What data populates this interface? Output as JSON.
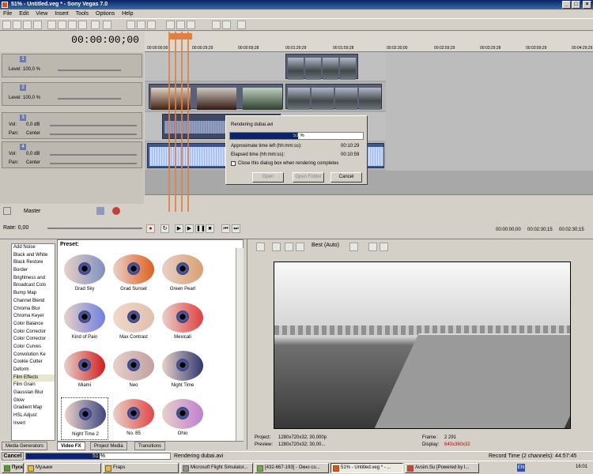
{
  "window": {
    "title": "51% - Untitled.veg * - Sony Vegas 7.0",
    "min": "_",
    "max": "□",
    "close": "×"
  },
  "menu": [
    "File",
    "Edit",
    "View",
    "Insert",
    "Tools",
    "Options",
    "Help"
  ],
  "timecode": "00:00:00;00",
  "ruler": [
    "00:00:00;00",
    "00:00:29;29",
    "00:00:59;28",
    "00:01:29;29",
    "00:01:59;28",
    "00:02:30;00",
    "00:02:59;29",
    "00:03:29;28",
    "00:03:59;29",
    "00:04:29;29"
  ],
  "tracks": [
    {
      "num": "1",
      "label": "Level:",
      "value": "100,0 %"
    },
    {
      "num": "2",
      "label": "Level:",
      "value": "100,0 %"
    },
    {
      "num": "3",
      "vol_label": "Vol:",
      "vol": "0,0 dB",
      "pan_label": "Pan:",
      "pan": "Center"
    },
    {
      "num": "4",
      "vol_label": "Vol:",
      "vol": "0,0 dB",
      "pan_label": "Pan:",
      "pan": "Center"
    }
  ],
  "master": "Master",
  "rate": "Rate: 0,00",
  "transport_time": [
    "00:00:00;00",
    "00:02:30;15",
    "00:02:30;15"
  ],
  "dialog": {
    "title": "Rendering dubai.avi",
    "progress": 0.51,
    "progress_text": "51 %",
    "approx_label": "Approximate time left (hh:mm:ss):",
    "approx": "00:10:29",
    "elapsed_label": "Elapsed time (hh:mm:ss):",
    "elapsed": "00:10:59",
    "close_label": "Close this dialog box when rendering completes",
    "open": "Open",
    "open_folder": "Open Folder",
    "cancel": "Cancel"
  },
  "fx_list": [
    "Add Noise",
    "Black and White",
    "Black Restore",
    "Border",
    "Brightness and",
    "Broadcast Colo",
    "Bump Map",
    "Channel Blend",
    "Chroma Blur",
    "Chroma Keyer",
    "Color Balance",
    "Color Corrector",
    "Color Corrector",
    "Color Curves",
    "Convolution Ke",
    "Cookie Cutter",
    "Deform",
    "Film Effects",
    "Film Grain",
    "Gaussian Blur",
    "Glow",
    "Gradient Map",
    "HSL Adjust",
    "Invert"
  ],
  "preset_label": "Preset:",
  "presets": [
    "Grad Sky",
    "Grad Sunset",
    "Green Pearl",
    "Kind of Pain",
    "Max Contrast",
    "Mexicali",
    "Miami",
    "Neo",
    "Night Time",
    "Night Time 2",
    "No. 85",
    "Ohio"
  ],
  "tabs": [
    "Media Generators",
    "Video FX",
    "Project Media",
    "Transitions"
  ],
  "preview": {
    "quality": "Best (Auto)",
    "project_label": "Project:",
    "project": "1280x720x32; 30,000p",
    "preview_label": "Preview:",
    "preview": "1280x720x32; 30,00...",
    "frame_label": "Frame:",
    "frame": "2 291",
    "display_label": "Display:",
    "display": "640x360x32"
  },
  "status": {
    "cancel": "Cancel",
    "progress_text": "51 %",
    "progress": 0.51,
    "message": "Rendering dubai.avi",
    "record": "Record Time (2 channels): 44:57:45"
  },
  "taskbar": {
    "start": "Пуск",
    "tasks": [
      "Музыки",
      "Fraps",
      "Microsoft Flight Simulator...",
      "[432-667-193] - Окно со...",
      "51% - Untitled.veg * - ...",
      "Avsim.Su [Powered by I..."
    ],
    "lang": "EN",
    "clock": "16:01"
  }
}
